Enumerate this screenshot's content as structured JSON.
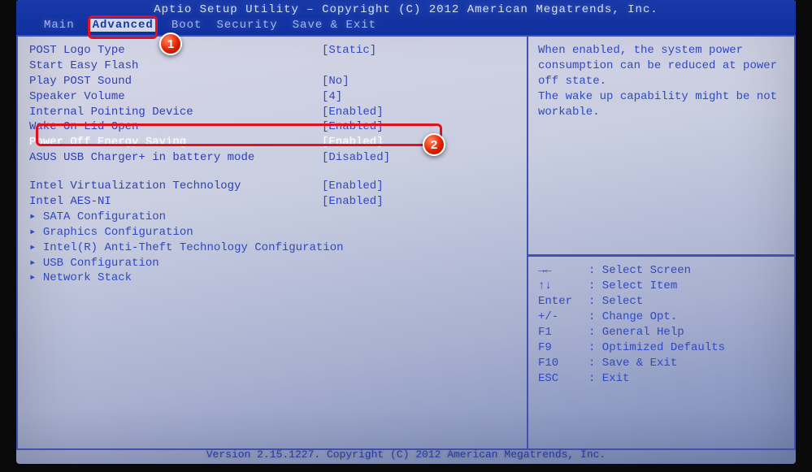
{
  "header": {
    "title": "Aptio Setup Utility – Copyright (C) 2012 American Megatrends, Inc."
  },
  "tabs": [
    {
      "label": "Main",
      "active": false
    },
    {
      "label": "Advanced",
      "active": true
    },
    {
      "label": "Boot",
      "active": false
    },
    {
      "label": "Security",
      "active": false
    },
    {
      "label": "Save & Exit",
      "active": false
    }
  ],
  "settings": [
    {
      "label": "POST Logo Type",
      "value": "[Static]",
      "selected": false
    },
    {
      "label": "Start Easy Flash",
      "value": "",
      "selected": false
    },
    {
      "label": "Play POST Sound",
      "value": "[No]",
      "selected": false
    },
    {
      "label": "Speaker Volume",
      "value": "[4]",
      "selected": false
    },
    {
      "label": "Internal Pointing Device",
      "value": "[Enabled]",
      "selected": false
    },
    {
      "label": "Wake On Lid Open",
      "value": "[Enabled]",
      "selected": false
    },
    {
      "label": "Power Off Energy Saving",
      "value": "[Enabled]",
      "selected": true
    },
    {
      "label": "ASUS USB Charger+ in battery mode",
      "value": "[Disabled]",
      "selected": false
    }
  ],
  "settings2": [
    {
      "label": "Intel Virtualization Technology",
      "value": "[Enabled]"
    },
    {
      "label": "Intel AES-NI",
      "value": "[Enabled]"
    }
  ],
  "submenus": [
    {
      "label": "▸ SATA Configuration"
    },
    {
      "label": "▸ Graphics Configuration"
    },
    {
      "label": "▸ Intel(R) Anti-Theft Technology Configuration"
    },
    {
      "label": "▸ USB Configuration"
    },
    {
      "label": "▸ Network Stack"
    }
  ],
  "help": {
    "text": "When enabled, the system power consumption can be reduced at power off state.\nThe wake up capability might be not workable."
  },
  "keys": [
    {
      "k": "→←",
      "d": ": Select Screen"
    },
    {
      "k": "↑↓",
      "d": ": Select Item"
    },
    {
      "k": "Enter",
      "d": ": Select"
    },
    {
      "k": "+/-",
      "d": ": Change Opt."
    },
    {
      "k": "F1",
      "d": ": General Help"
    },
    {
      "k": "F9",
      "d": ": Optimized Defaults"
    },
    {
      "k": "F10",
      "d": ": Save & Exit"
    },
    {
      "k": "ESC",
      "d": ": Exit"
    }
  ],
  "footer": "Version 2.15.1227. Copyright (C) 2012 American Megatrends, Inc.",
  "callouts": {
    "one": "1",
    "two": "2"
  }
}
